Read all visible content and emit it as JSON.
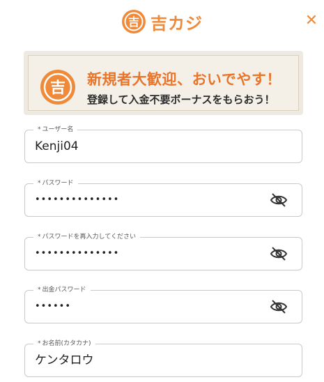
{
  "header": {
    "logo_text": "吉カジ",
    "logo_mark_char": "吉",
    "close_glyph": "✕"
  },
  "banner": {
    "title": "新規者大歓迎、おいでやす！",
    "subtitle": "登録して入金不要ボーナスをもらおう！",
    "icon_char": "吉"
  },
  "form": {
    "fields": [
      {
        "label": "ユーザー名",
        "value": "Kenji04",
        "type": "text"
      },
      {
        "label": "パスワード",
        "value": "••••••••••••••",
        "type": "password"
      },
      {
        "label": "パスワードを再入力してください",
        "value": "••••••••••••••",
        "type": "password"
      },
      {
        "label": "出金パスワード",
        "value": "••••••",
        "type": "password"
      },
      {
        "label": "お名前(カタカナ)",
        "value": "ケンタロウ",
        "type": "text"
      }
    ],
    "required_mark": "*"
  },
  "colors": {
    "brand": "#ef8a3a",
    "banner_title": "#e8752a",
    "border": "#c9c9c9"
  },
  "icons": {
    "visibility_toggle": "eye-off-icon",
    "close": "close-icon",
    "logo": "logo-mark-icon"
  }
}
